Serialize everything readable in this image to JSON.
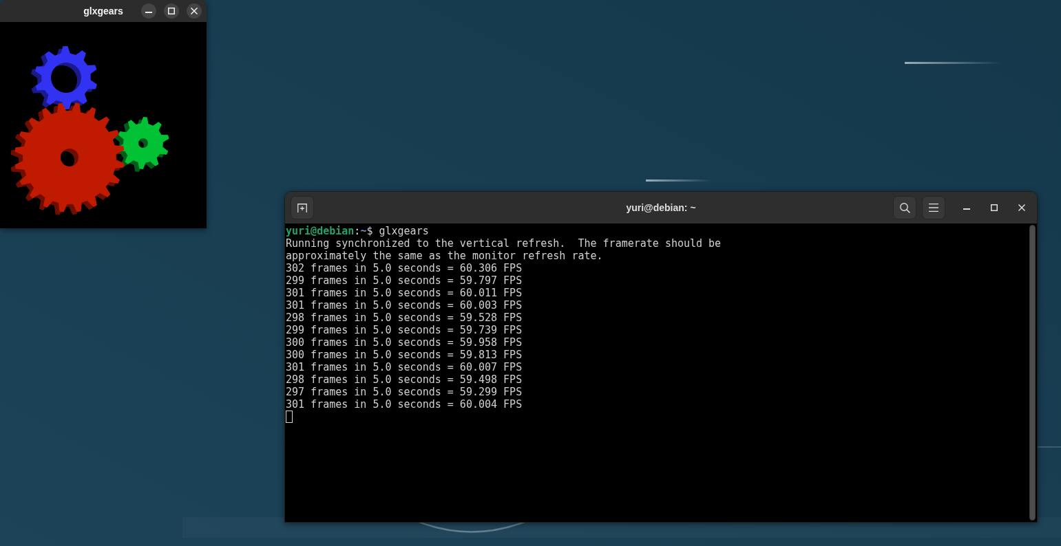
{
  "gears_window": {
    "title": "glxgears"
  },
  "terminal": {
    "title": "yuri@debian: ~",
    "prompt": {
      "user_host": "yuri@debian",
      "separator": ":",
      "path": "~",
      "symbol": "$",
      "command": "glxgears"
    },
    "output": [
      "Running synchronized to the vertical refresh.  The framerate should be",
      "approximately the same as the monitor refresh rate.",
      "302 frames in 5.0 seconds = 60.306 FPS",
      "299 frames in 5.0 seconds = 59.797 FPS",
      "301 frames in 5.0 seconds = 60.011 FPS",
      "301 frames in 5.0 seconds = 60.003 FPS",
      "298 frames in 5.0 seconds = 59.528 FPS",
      "299 frames in 5.0 seconds = 59.739 FPS",
      "300 frames in 5.0 seconds = 59.958 FPS",
      "300 frames in 5.0 seconds = 59.813 FPS",
      "301 frames in 5.0 seconds = 60.007 FPS",
      "298 frames in 5.0 seconds = 59.498 FPS",
      "297 frames in 5.0 seconds = 59.299 FPS",
      "301 frames in 5.0 seconds = 60.004 FPS"
    ]
  }
}
